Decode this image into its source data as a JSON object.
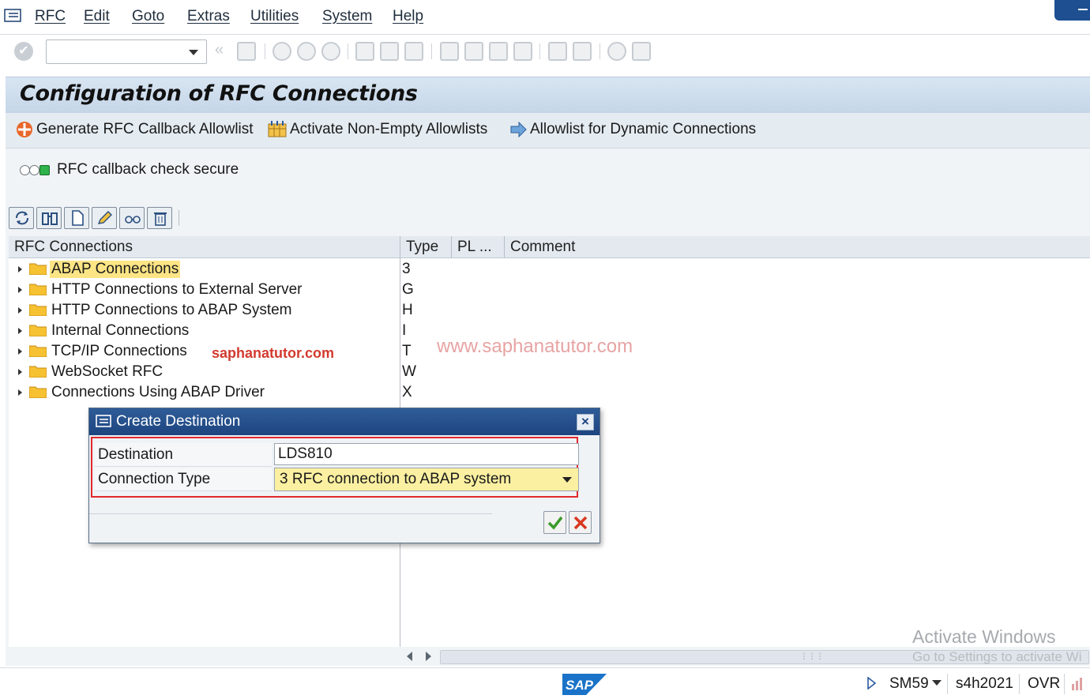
{
  "menu": {
    "items": [
      "RFC",
      "Edit",
      "Goto",
      "Extras",
      "Utilities",
      "System",
      "Help"
    ]
  },
  "toolbar": {
    "command_field_value": ""
  },
  "page": {
    "title": "Configuration of RFC Connections"
  },
  "app_toolbar": {
    "generate_label": "Generate RFC Callback Allowlist",
    "activate_label": "Activate Non-Empty Allowlists",
    "dynamic_label": "Allowlist for Dynamic Connections"
  },
  "status": {
    "callback_check": "RFC callback check secure"
  },
  "tree": {
    "columns": [
      "RFC Connections",
      "Type",
      "PL ...",
      "Comment"
    ],
    "rows": [
      {
        "label": "ABAP Connections",
        "type": "3"
      },
      {
        "label": "HTTP Connections to External Server",
        "type": "G"
      },
      {
        "label": "HTTP Connections to ABAP System",
        "type": "H"
      },
      {
        "label": "Internal Connections",
        "type": "I"
      },
      {
        "label": "TCP/IP Connections",
        "type": "T"
      },
      {
        "label": "WebSocket RFC",
        "type": "W"
      },
      {
        "label": "Connections Using ABAP Driver",
        "type": "X"
      }
    ],
    "selected_index": 0
  },
  "watermarks": {
    "left": "saphanatutor.com",
    "right": "www.saphanatutor.com"
  },
  "dialog": {
    "title": "Create Destination",
    "close_label": "×",
    "destination_label": "Destination",
    "destination_value": "LDS810",
    "connection_type_label": "Connection Type",
    "connection_type_value": "3 RFC connection to ABAP system"
  },
  "activate_windows": {
    "line1": "Activate Windows",
    "line2": "Go to Settings to activate Wi"
  },
  "statusbar": {
    "logo": "SAP",
    "transaction": "SM59",
    "system": "s4h2021",
    "mode": "OVR"
  },
  "colors": {
    "title_bar": "#c5d6e8",
    "dialog_title": "#1d4580",
    "highlight": "#fde585",
    "red_frame": "#e0282c",
    "select_bg": "#fbf0a1"
  }
}
